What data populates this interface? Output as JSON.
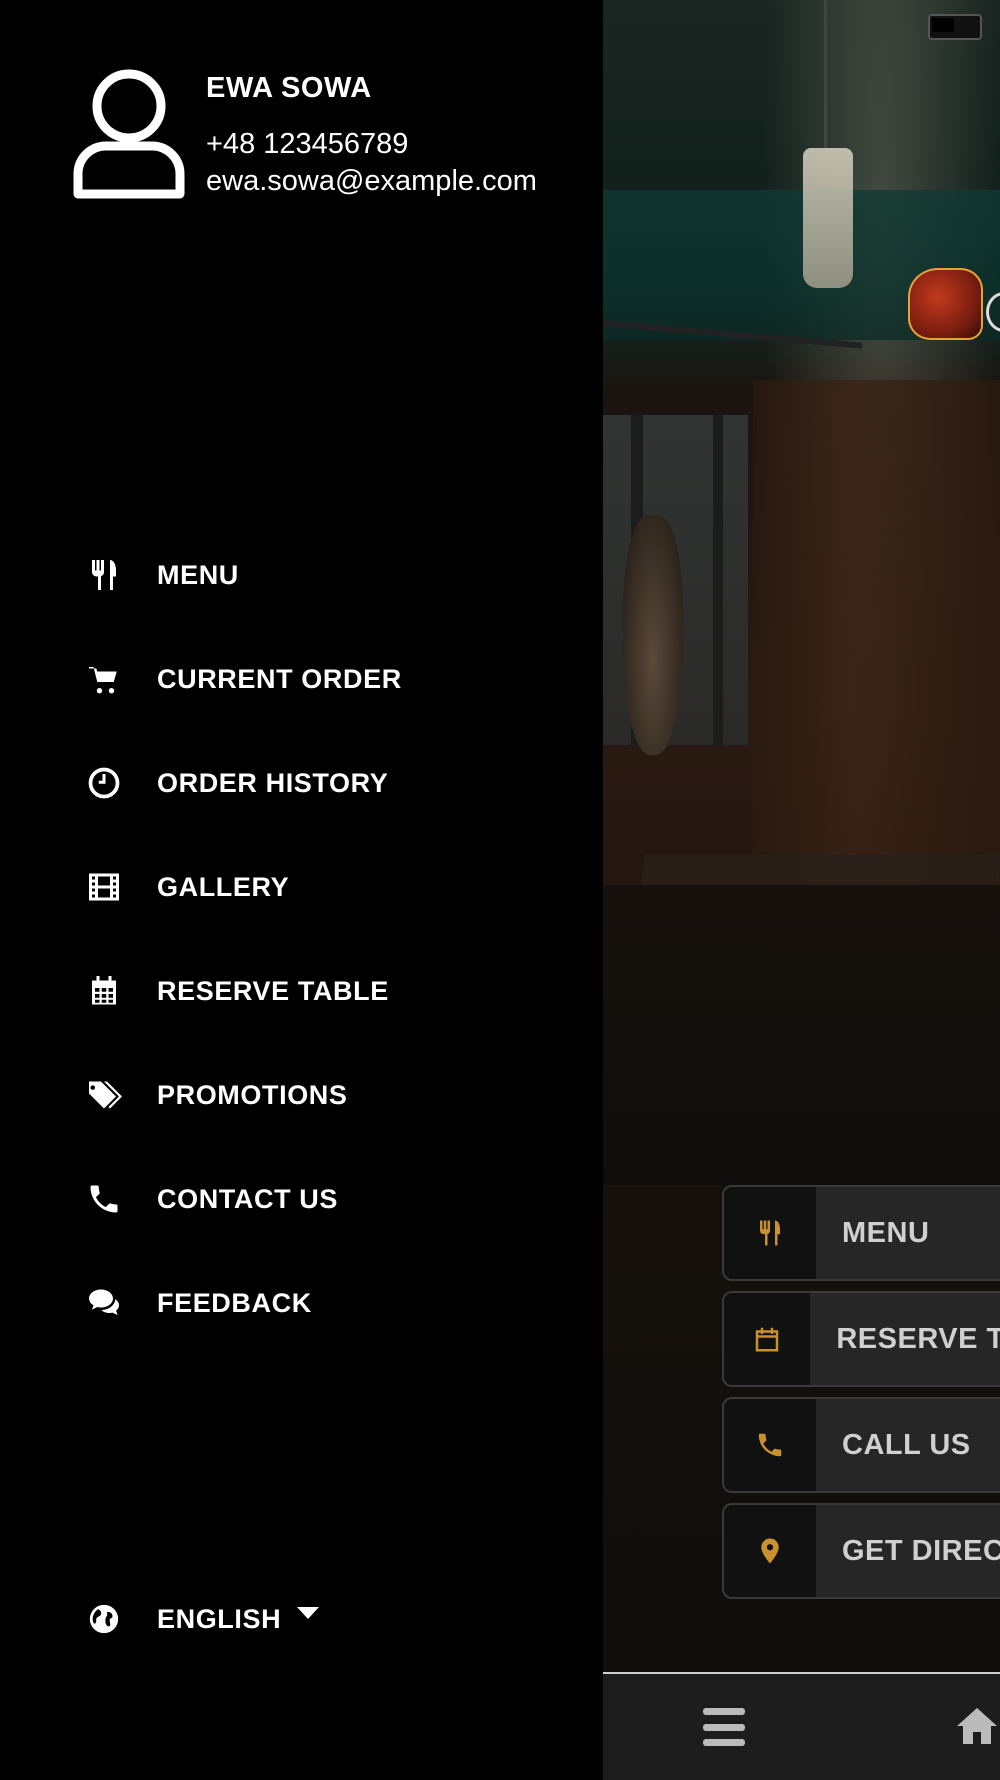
{
  "profile": {
    "name": "EWA SOWA",
    "phone": "+48 123456789",
    "email": "ewa.sowa@example.com"
  },
  "nav": {
    "items": [
      {
        "label": "MENU",
        "icon": "utensils-icon"
      },
      {
        "label": "CURRENT ORDER",
        "icon": "cart-icon"
      },
      {
        "label": "ORDER HISTORY",
        "icon": "clock-icon"
      },
      {
        "label": "GALLERY",
        "icon": "film-icon"
      },
      {
        "label": "RESERVE TABLE",
        "icon": "calendar-icon"
      },
      {
        "label": "PROMOTIONS",
        "icon": "tags-icon"
      },
      {
        "label": "CONTACT US",
        "icon": "phone-icon"
      },
      {
        "label": "FEEDBACK",
        "icon": "comments-icon"
      }
    ]
  },
  "language": {
    "label": "ENGLISH",
    "icon": "globe-icon"
  },
  "quick_actions": [
    {
      "label": "MENU",
      "icon": "utensils-icon"
    },
    {
      "label": "RESERVE TA",
      "icon": "calendar-icon"
    },
    {
      "label": "CALL US",
      "icon": "phone-icon"
    },
    {
      "label": "GET DIRECT",
      "icon": "map-pin-icon"
    }
  ],
  "colors": {
    "accent": "#c8912e",
    "drawer_bg": "#000000",
    "text": "#ffffff"
  }
}
